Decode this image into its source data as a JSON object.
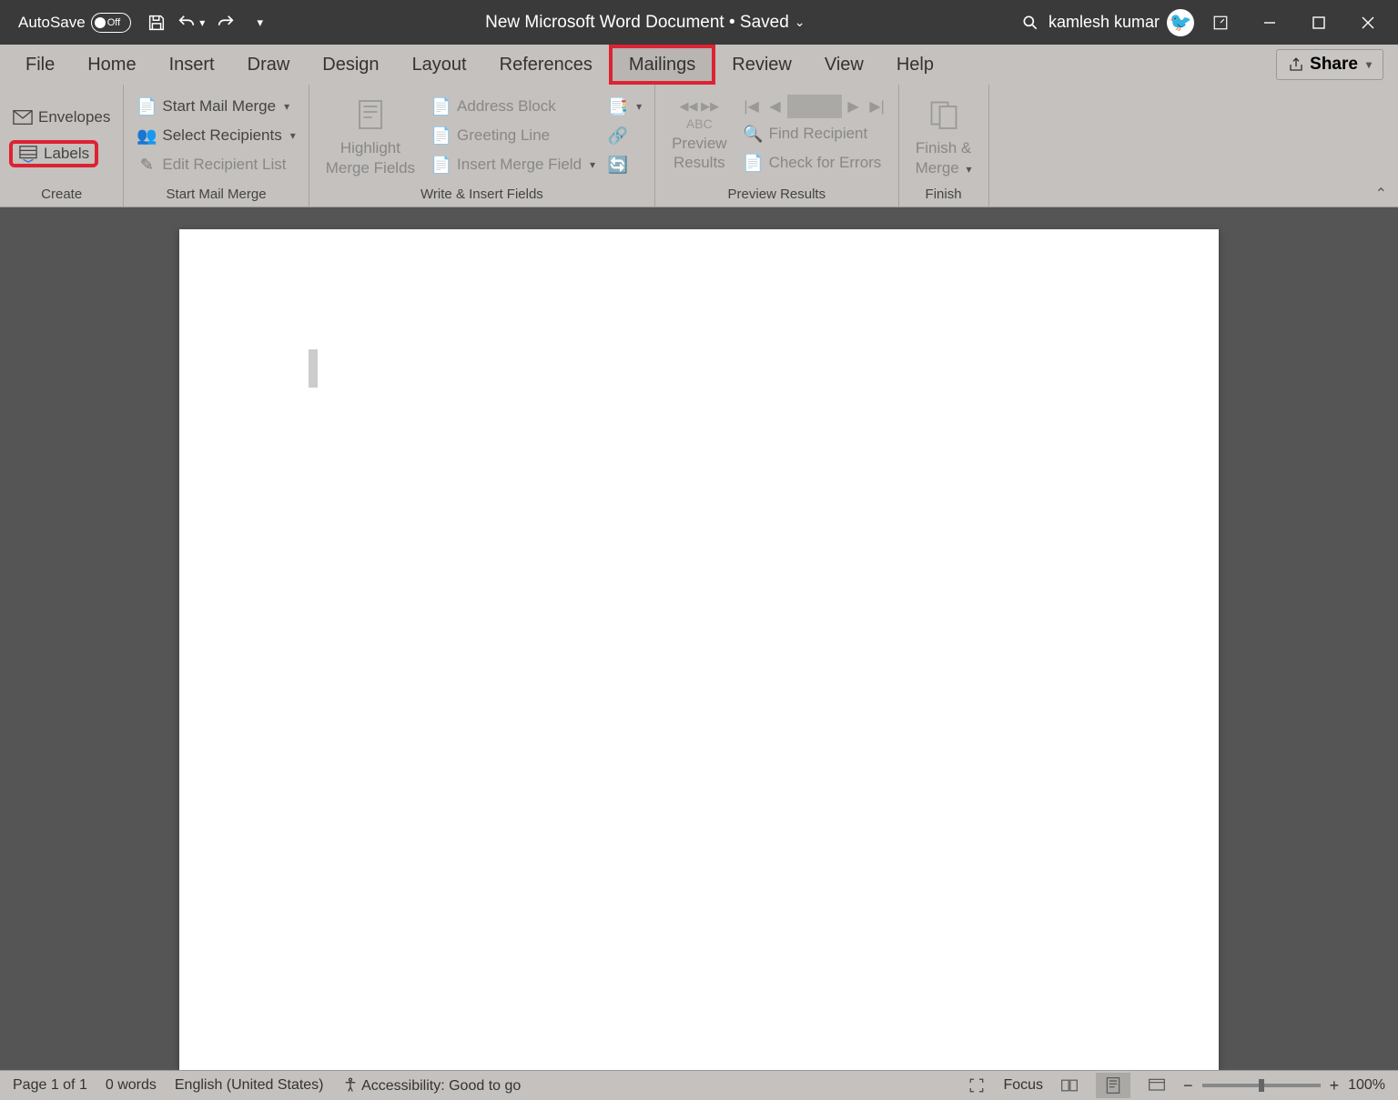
{
  "titlebar": {
    "autosave_label": "AutoSave",
    "autosave_state": "Off",
    "doc_title": "New Microsoft Word Document • Saved",
    "user_name": "kamlesh kumar"
  },
  "tabs": {
    "file": "File",
    "home": "Home",
    "insert": "Insert",
    "draw": "Draw",
    "design": "Design",
    "layout": "Layout",
    "references": "References",
    "mailings": "Mailings",
    "review": "Review",
    "view": "View",
    "help": "Help",
    "share": "Share"
  },
  "ribbon": {
    "create": {
      "envelopes": "Envelopes",
      "labels": "Labels",
      "group": "Create"
    },
    "startmm": {
      "start": "Start Mail Merge",
      "select": "Select Recipients",
      "edit": "Edit Recipient List",
      "group": "Start Mail Merge"
    },
    "write": {
      "highlight1": "Highlight",
      "highlight2": "Merge Fields",
      "address": "Address Block",
      "greeting": "Greeting Line",
      "insertfield": "Insert Merge Field",
      "group": "Write & Insert Fields"
    },
    "preview": {
      "abc": "ABC",
      "preview1": "Preview",
      "preview2": "Results",
      "find": "Find Recipient",
      "check": "Check for Errors",
      "group": "Preview Results"
    },
    "finish": {
      "finish1": "Finish &",
      "finish2": "Merge",
      "group": "Finish"
    }
  },
  "status": {
    "page": "Page 1 of 1",
    "words": "0 words",
    "lang": "English (United States)",
    "access": "Accessibility: Good to go",
    "focus": "Focus",
    "zoom": "100%"
  }
}
